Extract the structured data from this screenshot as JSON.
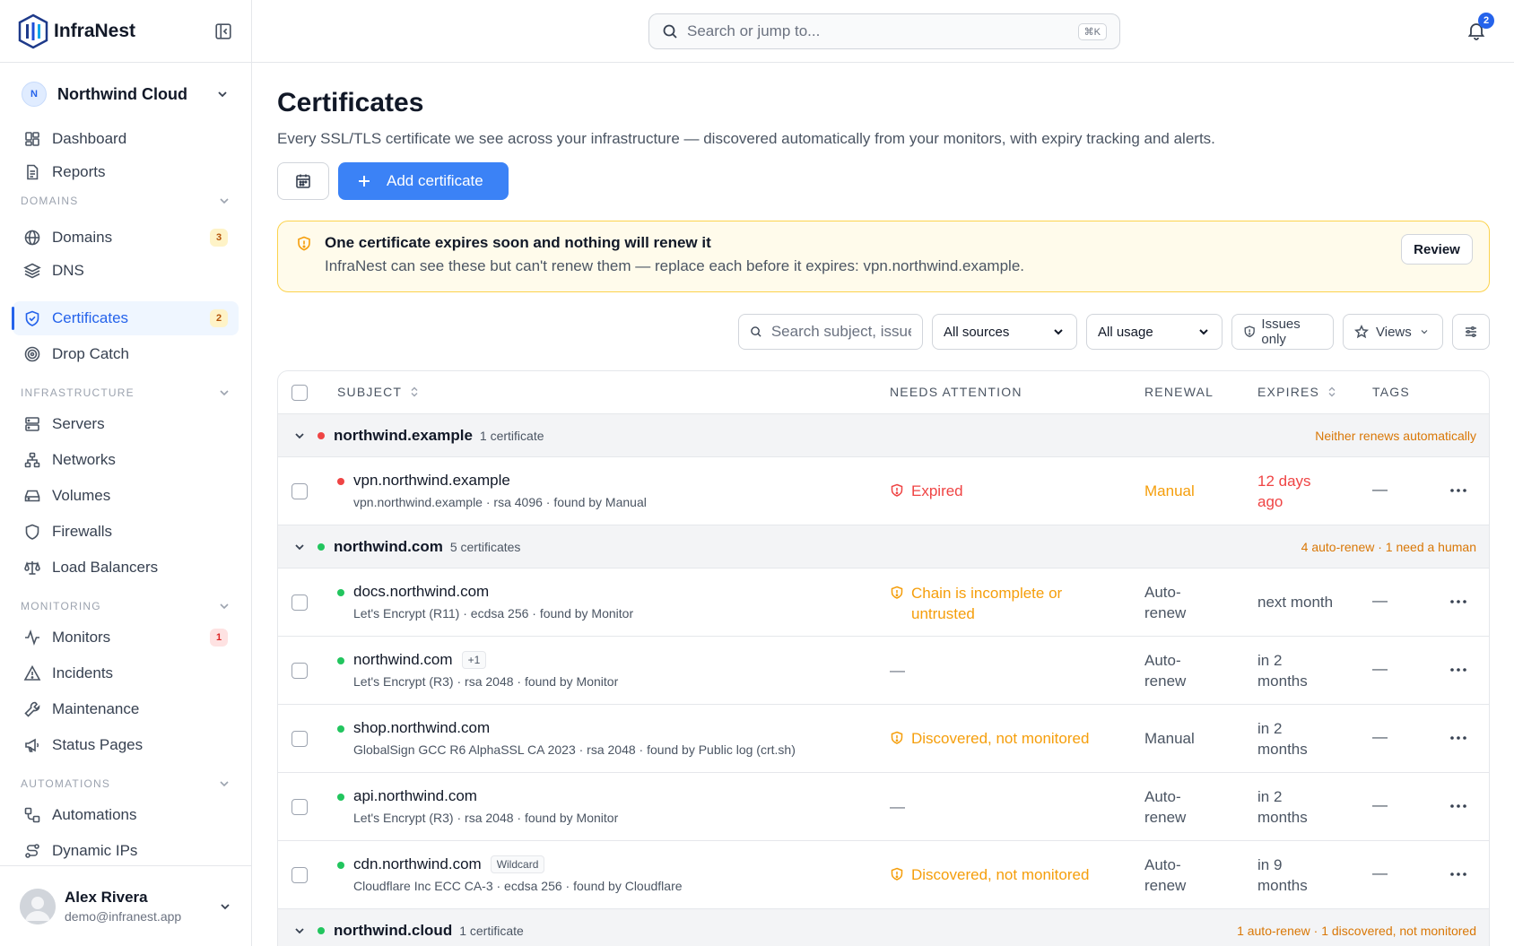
{
  "brand": {
    "name": "InfraNest"
  },
  "org": {
    "initial": "N",
    "name": "Northwind Cloud"
  },
  "nav": {
    "dashboard": "Dashboard",
    "reports": "Reports",
    "domains_section": "DOMAINS",
    "domains": "Domains",
    "domains_badge": "3",
    "dns": "DNS",
    "certificates": "Certificates",
    "certificates_badge": "2",
    "drop_catch": "Drop Catch",
    "infra_section": "INFRASTRUCTURE",
    "servers": "Servers",
    "networks": "Networks",
    "volumes": "Volumes",
    "firewalls": "Firewalls",
    "load_balancers": "Load Balancers",
    "monitoring_section": "MONITORING",
    "monitors": "Monitors",
    "monitors_badge": "1",
    "incidents": "Incidents",
    "maintenance": "Maintenance",
    "status_pages": "Status Pages",
    "automations_section": "AUTOMATIONS",
    "automations": "Automations",
    "dynamic_ips": "Dynamic IPs"
  },
  "user": {
    "name": "Alex Rivera",
    "email": "demo@infranest.app"
  },
  "topbar": {
    "search_placeholder": "Search or jump to...",
    "shortcut": "⌘K",
    "notif_count": "2"
  },
  "page": {
    "title": "Certificates",
    "subtitle": "Every SSL/TLS certificate we see across your infrastructure — discovered automatically from your monitors, with expiry tracking and alerts.",
    "add_button": "Add certificate"
  },
  "alert": {
    "heading": "One certificate expires soon and nothing will renew it",
    "body": "InfraNest can see these but can't renew them — replace each before it expires: vpn.northwind.example.",
    "action": "Review"
  },
  "filters": {
    "search_placeholder": "Search subject, issuer...",
    "sources": "All sources",
    "usage": "All usage",
    "issues_only": "Issues only",
    "views": "Views"
  },
  "table": {
    "headers": {
      "subject": "SUBJECT",
      "attention": "NEEDS ATTENTION",
      "renewal": "RENEWAL",
      "expires": "EXPIRES",
      "tags": "TAGS"
    },
    "groups": [
      {
        "name": "northwind.example",
        "count": "1 certificate",
        "note": "Neither renews automatically",
        "rows": [
          {
            "subject": "vpn.northwind.example",
            "meta": "vpn.northwind.example · rsa 4096 · found by Manual",
            "attention": "Expired",
            "renewal": "Manual",
            "expires": "12 days ago",
            "tags": "—"
          }
        ]
      },
      {
        "name": "northwind.com",
        "count": "5 certificates",
        "note": "4 auto-renew · 1 need a human",
        "rows": [
          {
            "subject": "docs.northwind.com",
            "meta": "Let's Encrypt (R11) · ecdsa 256 · found by Monitor",
            "attention": "Chain is incomplete or untrusted",
            "renewal": "Auto-renew",
            "expires": "next month",
            "tags": "—"
          },
          {
            "subject": "northwind.com",
            "tag": "+1",
            "meta": "Let's Encrypt (R3) · rsa 2048 · found by Monitor",
            "attention": "—",
            "renewal": "Auto-renew",
            "expires": "in 2 months",
            "tags": "—"
          },
          {
            "subject": "shop.northwind.com",
            "meta": "GlobalSign GCC R6 AlphaSSL CA 2023 · rsa 2048 · found by Public log (crt.sh)",
            "attention": "Discovered, not monitored",
            "renewal": "Manual",
            "expires": "in 2 months",
            "tags": "—"
          },
          {
            "subject": "api.northwind.com",
            "meta": "Let's Encrypt (R3) · rsa 2048 · found by Monitor",
            "attention": "—",
            "renewal": "Auto-renew",
            "expires": "in 2 months",
            "tags": "—"
          },
          {
            "subject": "cdn.northwind.com",
            "tag": "Wildcard",
            "meta": "Cloudflare Inc ECC CA-3 · ecdsa 256 · found by Cloudflare",
            "attention": "Discovered, not monitored",
            "renewal": "Auto-renew",
            "expires": "in 9 months",
            "tags": "—"
          }
        ]
      },
      {
        "name": "northwind.cloud",
        "count": "1 certificate",
        "note": "1 auto-renew · 1 discovered, not monitored",
        "rows": []
      }
    ]
  },
  "colors": {
    "accent": "#3b82f6",
    "danger": "#ef4444",
    "warning": "#f59e0b",
    "success": "#22c55e"
  }
}
